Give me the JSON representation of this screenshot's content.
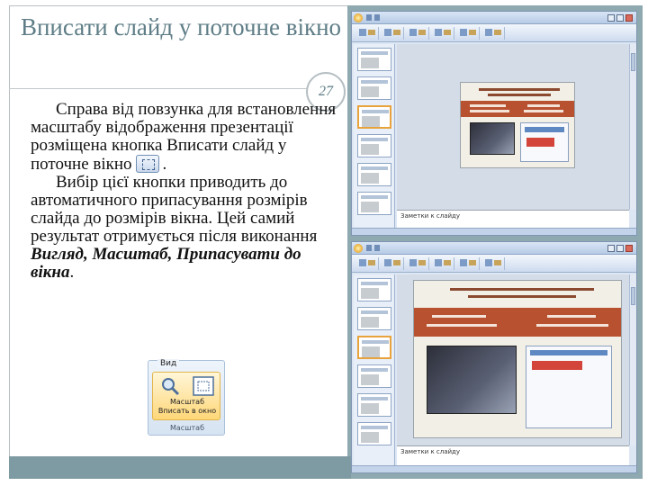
{
  "slide": {
    "title": "Вписати слайд у поточне вікно",
    "page_number": "27",
    "paragraph1": "Справа від повзунка для встановлення масштабу відображення презентації розміщена кнопка Вписати слайд у поточне вікно",
    "paragraph1_end": ".",
    "paragraph2_start": "Вибір цієї кнопки приводить до автоматичного припасування розмірів слайда до розмірів вікна. Цей самий результат отримується після виконання ",
    "paragraph2_emph": "Вигляд, Масштаб, Припасувати до вікна",
    "paragraph2_end": "."
  },
  "ribbon": {
    "tab_label": "Вид",
    "button_label": "Масштаб Вписать в окно",
    "group_label": "Масштаб"
  },
  "screenshot_top": {
    "notes_text": "Заметки к слайду"
  },
  "screenshot_bottom": {
    "notes_text": "Заметки к слайду"
  },
  "colors": {
    "title": "#5e7d86",
    "band": "#8fa9b0",
    "slide_band": "#b8512f"
  }
}
